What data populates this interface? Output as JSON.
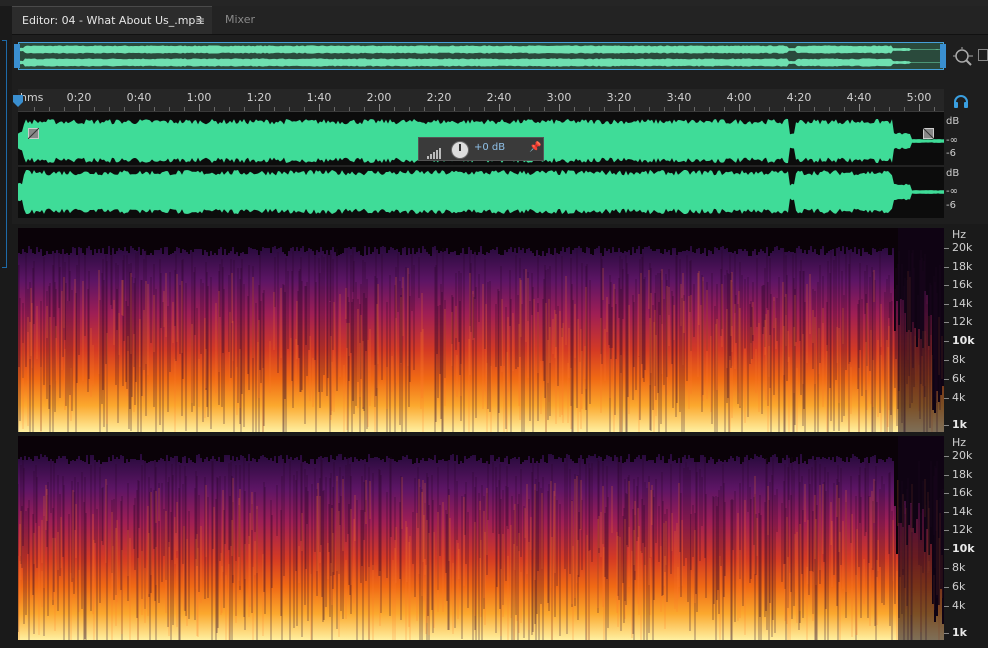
{
  "tabs": [
    {
      "label": "Editor: 04 - What About Us_.mp3",
      "menu_glyph": "≡",
      "active": true
    },
    {
      "label": "Mixer",
      "active": false
    }
  ],
  "ruler": {
    "unit_label": "hms",
    "ticks": [
      "0:20",
      "0:40",
      "1:00",
      "1:20",
      "1:40",
      "2:00",
      "2:20",
      "2:40",
      "3:00",
      "3:20",
      "3:40",
      "4:00",
      "4:20",
      "4:40",
      "5:00"
    ]
  },
  "waveform": {
    "channels": [
      {
        "db_labels": [
          "dB",
          "-∞",
          "-6"
        ]
      },
      {
        "db_labels": [
          "dB",
          "-∞",
          "-6"
        ]
      }
    ],
    "color": "#3fdc98"
  },
  "hud": {
    "volume": "+0 dB"
  },
  "spectral": {
    "channels": [
      {
        "hz_labels": [
          "Hz",
          "20k",
          "18k",
          "16k",
          "14k",
          "12k",
          "10k",
          "8k",
          "6k",
          "4k",
          "1k"
        ]
      },
      {
        "hz_labels": [
          "Hz",
          "20k",
          "18k",
          "16k",
          "14k",
          "12k",
          "10k",
          "8k",
          "6k",
          "4k",
          "1k"
        ]
      }
    ]
  },
  "colors": {
    "accent": "#46a0d8",
    "waveform": "#3fdc98",
    "background": "#1e1e1e"
  },
  "icons": [
    "zoom-icon",
    "headphones-icon",
    "playhead-icon",
    "fade-in-handle-icon",
    "fade-out-handle-icon",
    "level-meter-icon",
    "volume-knob-icon",
    "pin-icon",
    "panel-menu-icon"
  ]
}
